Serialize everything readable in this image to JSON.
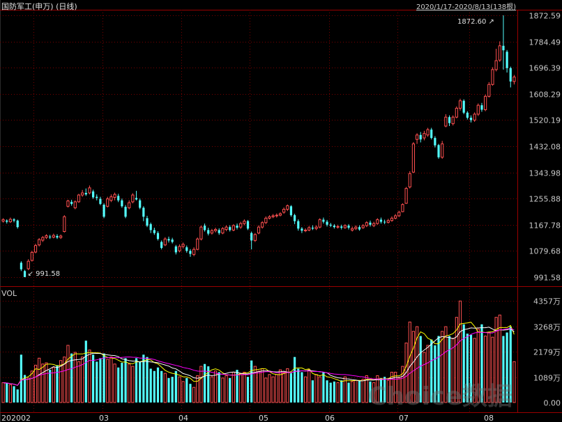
{
  "header": {
    "title": "国防军工(申万) (日线)",
    "range": "2020/1/17-2020/8/13(138根)"
  },
  "volume_panel": {
    "label": "VOL"
  },
  "watermark": "Choice数据",
  "colors": {
    "up": "#ff5050",
    "down": "#54ffff",
    "grid": "#7a0000",
    "axis_text": "#c8c8c8",
    "ma5": "#ffff00",
    "ma10": "#ff00ff",
    "ma20": "#ffffff"
  },
  "chart_data": [
    {
      "type": "candlestick",
      "title": "国防军工(申万) (日线)",
      "date_range": "2020/1/17-2020/8/13",
      "bars": 138,
      "y_ticks": [
        "1872.59",
        "1784.49",
        "1696.39",
        "1608.29",
        "1520.19",
        "1432.08",
        "1343.98",
        "1255.88",
        "1167.78",
        "1079.68",
        "991.58"
      ],
      "ylim": [
        991.58,
        1872.59
      ],
      "x_tick_labels": [
        "2020",
        "02",
        "03",
        "04",
        "05",
        "06",
        "07",
        "08"
      ],
      "annotations": [
        {
          "text": "1872.60",
          "type": "max"
        },
        {
          "text": "991.58",
          "type": "min"
        }
      ],
      "candles": [
        [
          1180,
          1185,
          1190,
          1175
        ],
        [
          1182,
          1178,
          1186,
          1172
        ],
        [
          1178,
          1186,
          1192,
          1174
        ],
        [
          1186,
          1182,
          1190,
          1176
        ],
        [
          1182,
          1160,
          1185,
          1155
        ],
        [
          1040,
          1018,
          1045,
          1012
        ],
        [
          1012,
          992,
          1016,
          991.58
        ],
        [
          1020,
          1045,
          1052,
          1015
        ],
        [
          1048,
          1075,
          1080,
          1044
        ],
        [
          1076,
          1098,
          1104,
          1072
        ],
        [
          1100,
          1118,
          1123,
          1095
        ],
        [
          1116,
          1125,
          1130,
          1110
        ],
        [
          1125,
          1131,
          1136,
          1120
        ],
        [
          1128,
          1127,
          1134,
          1120
        ],
        [
          1126,
          1132,
          1138,
          1122
        ],
        [
          1130,
          1125,
          1136,
          1120
        ],
        [
          1125,
          1130,
          1135,
          1120
        ],
        [
          1145,
          1195,
          1200,
          1142
        ],
        [
          1230,
          1248,
          1252,
          1226
        ],
        [
          1245,
          1238,
          1252,
          1232
        ],
        [
          1225,
          1245,
          1250,
          1220
        ],
        [
          1245,
          1268,
          1272,
          1242
        ],
        [
          1268,
          1275,
          1285,
          1262
        ],
        [
          1275,
          1270,
          1290,
          1265
        ],
        [
          1275,
          1292,
          1300,
          1270
        ],
        [
          1280,
          1260,
          1286,
          1255
        ],
        [
          1262,
          1258,
          1270,
          1250
        ],
        [
          1255,
          1238,
          1262,
          1234
        ],
        [
          1235,
          1195,
          1240,
          1190
        ],
        [
          1230,
          1255,
          1262,
          1226
        ],
        [
          1250,
          1262,
          1270,
          1244
        ],
        [
          1260,
          1270,
          1276,
          1250
        ],
        [
          1265,
          1250,
          1272,
          1244
        ],
        [
          1250,
          1230,
          1256,
          1225
        ],
        [
          1228,
          1195,
          1234,
          1190
        ],
        [
          1225,
          1242,
          1250,
          1220
        ],
        [
          1245,
          1268,
          1274,
          1240
        ],
        [
          1258,
          1253,
          1282,
          1250
        ],
        [
          1250,
          1225,
          1256,
          1220
        ],
        [
          1225,
          1195,
          1230,
          1180
        ],
        [
          1190,
          1165,
          1198,
          1160
        ],
        [
          1170,
          1150,
          1175,
          1140
        ],
        [
          1150,
          1140,
          1158,
          1134
        ],
        [
          1140,
          1120,
          1146,
          1115
        ],
        [
          1110,
          1090,
          1115,
          1085
        ],
        [
          1100,
          1120,
          1126,
          1096
        ],
        [
          1120,
          1115,
          1128,
          1108
        ],
        [
          1118,
          1110,
          1124,
          1105
        ],
        [
          1095,
          1075,
          1100,
          1068
        ],
        [
          1080,
          1095,
          1102,
          1075
        ],
        [
          1095,
          1102,
          1108,
          1088
        ],
        [
          1092,
          1080,
          1098,
          1074
        ],
        [
          1080,
          1070,
          1086,
          1060
        ],
        [
          1068,
          1085,
          1092,
          1062
        ],
        [
          1085,
          1120,
          1125,
          1082
        ],
        [
          1120,
          1160,
          1165,
          1115
        ],
        [
          1165,
          1150,
          1172,
          1145
        ],
        [
          1150,
          1138,
          1158,
          1132
        ],
        [
          1140,
          1148,
          1154,
          1135
        ],
        [
          1148,
          1152,
          1158,
          1142
        ],
        [
          1150,
          1140,
          1156,
          1134
        ],
        [
          1140,
          1155,
          1160,
          1136
        ],
        [
          1152,
          1160,
          1166,
          1146
        ],
        [
          1160,
          1150,
          1166,
          1145
        ],
        [
          1150,
          1165,
          1170,
          1146
        ],
        [
          1165,
          1158,
          1172,
          1152
        ],
        [
          1160,
          1172,
          1178,
          1154
        ],
        [
          1172,
          1180,
          1186,
          1166
        ],
        [
          1180,
          1155,
          1184,
          1150
        ],
        [
          1140,
          1115,
          1145,
          1085
        ],
        [
          1115,
          1135,
          1140,
          1110
        ],
        [
          1140,
          1160,
          1166,
          1136
        ],
        [
          1160,
          1175,
          1180,
          1155
        ],
        [
          1175,
          1190,
          1196,
          1170
        ],
        [
          1190,
          1195,
          1200,
          1186
        ],
        [
          1195,
          1198,
          1204,
          1190
        ],
        [
          1198,
          1200,
          1206,
          1192
        ],
        [
          1200,
          1205,
          1210,
          1196
        ],
        [
          1210,
          1220,
          1226,
          1205
        ],
        [
          1220,
          1232,
          1236,
          1214
        ],
        [
          1230,
          1200,
          1234,
          1195
        ],
        [
          1200,
          1180,
          1205,
          1170
        ],
        [
          1180,
          1155,
          1186,
          1148
        ],
        [
          1155,
          1148,
          1160,
          1140
        ],
        [
          1148,
          1150,
          1156,
          1143
        ],
        [
          1150,
          1158,
          1164,
          1146
        ],
        [
          1158,
          1155,
          1166,
          1150
        ],
        [
          1155,
          1160,
          1166,
          1150
        ],
        [
          1160,
          1185,
          1190,
          1156
        ],
        [
          1185,
          1178,
          1192,
          1172
        ],
        [
          1178,
          1168,
          1184,
          1162
        ],
        [
          1168,
          1165,
          1174,
          1160
        ],
        [
          1165,
          1160,
          1170,
          1155
        ],
        [
          1160,
          1162,
          1168,
          1155
        ],
        [
          1162,
          1158,
          1168,
          1152
        ],
        [
          1158,
          1165,
          1170,
          1154
        ],
        [
          1165,
          1158,
          1170,
          1152
        ],
        [
          1150,
          1155,
          1162,
          1145
        ],
        [
          1155,
          1160,
          1166,
          1150
        ],
        [
          1160,
          1152,
          1166,
          1148
        ],
        [
          1158,
          1165,
          1170,
          1154
        ],
        [
          1165,
          1175,
          1180,
          1160
        ],
        [
          1175,
          1168,
          1182,
          1162
        ],
        [
          1165,
          1172,
          1178,
          1160
        ],
        [
          1172,
          1185,
          1190,
          1168
        ],
        [
          1185,
          1178,
          1192,
          1172
        ],
        [
          1178,
          1176,
          1185,
          1170
        ],
        [
          1176,
          1182,
          1188,
          1172
        ],
        [
          1182,
          1190,
          1196,
          1178
        ],
        [
          1190,
          1198,
          1204,
          1186
        ],
        [
          1198,
          1210,
          1215,
          1194
        ],
        [
          1212,
          1236,
          1240,
          1210
        ],
        [
          1240,
          1290,
          1295,
          1238
        ],
        [
          1295,
          1340,
          1348,
          1290
        ],
        [
          1345,
          1440,
          1446,
          1342
        ],
        [
          1455,
          1470,
          1476,
          1440
        ],
        [
          1470,
          1455,
          1480,
          1445
        ],
        [
          1460,
          1475,
          1484,
          1452
        ],
        [
          1470,
          1488,
          1494,
          1464
        ],
        [
          1488,
          1460,
          1494,
          1455
        ],
        [
          1460,
          1435,
          1466,
          1428
        ],
        [
          1436,
          1395,
          1440,
          1390
        ],
        [
          1395,
          1440,
          1450,
          1390
        ],
        [
          1500,
          1530,
          1540,
          1496
        ],
        [
          1530,
          1510,
          1536,
          1500
        ],
        [
          1508,
          1530,
          1536,
          1502
        ],
        [
          1530,
          1560,
          1566,
          1526
        ],
        [
          1560,
          1585,
          1592,
          1552
        ],
        [
          1585,
          1545,
          1590,
          1540
        ],
        [
          1545,
          1528,
          1550,
          1522
        ],
        [
          1528,
          1520,
          1536,
          1512
        ],
        [
          1520,
          1540,
          1546,
          1514
        ],
        [
          1540,
          1570,
          1576,
          1534
        ],
        [
          1570,
          1555,
          1578,
          1548
        ],
        [
          1555,
          1600,
          1606,
          1550
        ],
        [
          1600,
          1640,
          1648,
          1596
        ],
        [
          1640,
          1690,
          1698,
          1636
        ],
        [
          1690,
          1720,
          1760,
          1684
        ],
        [
          1722,
          1770,
          1785,
          1716
        ],
        [
          1770,
          1755,
          1872.6,
          1690
        ],
        [
          1750,
          1695,
          1756,
          1680
        ],
        [
          1695,
          1650,
          1700,
          1630
        ],
        [
          1650,
          1665,
          1672,
          1640
        ]
      ],
      "volume": {
        "label": "VOL",
        "y_ticks": [
          "4357万",
          "3268万",
          "2179万",
          "1089万",
          "0.00"
        ],
        "ylim": [
          0,
          4357
        ],
        "unit": "万",
        "values": [
          850,
          820,
          760,
          700,
          560,
          2050,
          1180,
          1050,
          1350,
          1600,
          1900,
          1650,
          1700,
          1400,
          1500,
          1600,
          1800,
          1950,
          2450,
          2100,
          2150,
          1750,
          1950,
          2650,
          2250,
          2050,
          1750,
          1900,
          2100,
          1850,
          1950,
          1650,
          1500,
          1700,
          1900,
          1650,
          1550,
          1900,
          1750,
          2050,
          1950,
          1450,
          1350,
          1500,
          1350,
          1250,
          1050,
          1100,
          1350,
          1100,
          900,
          1050,
          800,
          650,
          1150,
          1550,
          1650,
          1550,
          1100,
          1350,
          1300,
          1050,
          1150,
          1050,
          1300,
          1400,
          1250,
          1300,
          1100,
          1800,
          1550,
          1350,
          1450,
          1050,
          1200,
          1100,
          1200,
          1400,
          1300,
          1450,
          1250,
          1950,
          1450,
          1300,
          1100,
          1400,
          950,
          1200,
          1100,
          1300,
          950,
          850,
          900,
          850,
          950,
          1100,
          850,
          900,
          950,
          950,
          1000,
          1150,
          900,
          850,
          1150,
          1050,
          1100,
          950,
          1300,
          1300,
          1050,
          1550,
          2550,
          3450,
          3050,
          3250,
          2850,
          2150,
          2450,
          2700,
          2450,
          2850,
          3050,
          3250,
          2850,
          2750,
          3650,
          4350,
          3350,
          2950,
          2900,
          2750,
          3150,
          3350,
          2850,
          3000,
          2800,
          3650,
          3750,
          2850,
          3000,
          3250,
          1750
        ]
      }
    }
  ]
}
